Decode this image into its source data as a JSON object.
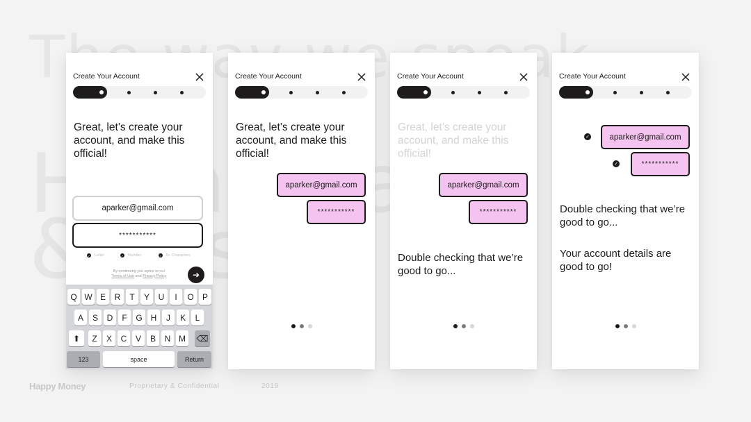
{
  "background": {
    "heading_lines": [
      "The way we speak",
      "H u m a n   a n d   h e l p f u l",
      "&   h o n e s t   s t r a i g h t n"
    ]
  },
  "common": {
    "header_title": "Create Your Account",
    "email": "aparker@gmail.com",
    "password_masked": "***********",
    "greeting": "Great, let’s create your account, and make this official!",
    "checking": "Double checking that we’re good to go...",
    "confirmed": "Your account details are good to go!",
    "progress_step": 1,
    "progress_total": 4
  },
  "screen1": {
    "requirements": [
      "Letter",
      "Number",
      "8+ Characters"
    ],
    "terms_line1": "By continuing you agree to our",
    "terms_link1": "Terms of Use",
    "terms_and": "and",
    "terms_link2": "Privacy Policy",
    "next_icon": "arrow-right-icon",
    "keyboard": {
      "row1": [
        "Q",
        "W",
        "E",
        "R",
        "T",
        "Y",
        "U",
        "I",
        "O",
        "P"
      ],
      "row2": [
        "A",
        "S",
        "D",
        "F",
        "G",
        "H",
        "J",
        "K",
        "L"
      ],
      "row3": [
        "Z",
        "X",
        "C",
        "V",
        "B",
        "N",
        "M"
      ],
      "shift_icon": "⬆",
      "delete_icon": "⌫",
      "numbers_label": "123",
      "space_label": "space",
      "return_label": "Return"
    }
  },
  "pager": {
    "active_page": 1,
    "total_pages": 3
  },
  "colors": {
    "bubble_pink": "#f5c3ef",
    "ink": "#1d1b1c",
    "faded": "#d3d3d3"
  },
  "footer": {
    "brand": "Happy Money",
    "confidential": "Proprietary & Confidential",
    "year": "2019"
  }
}
